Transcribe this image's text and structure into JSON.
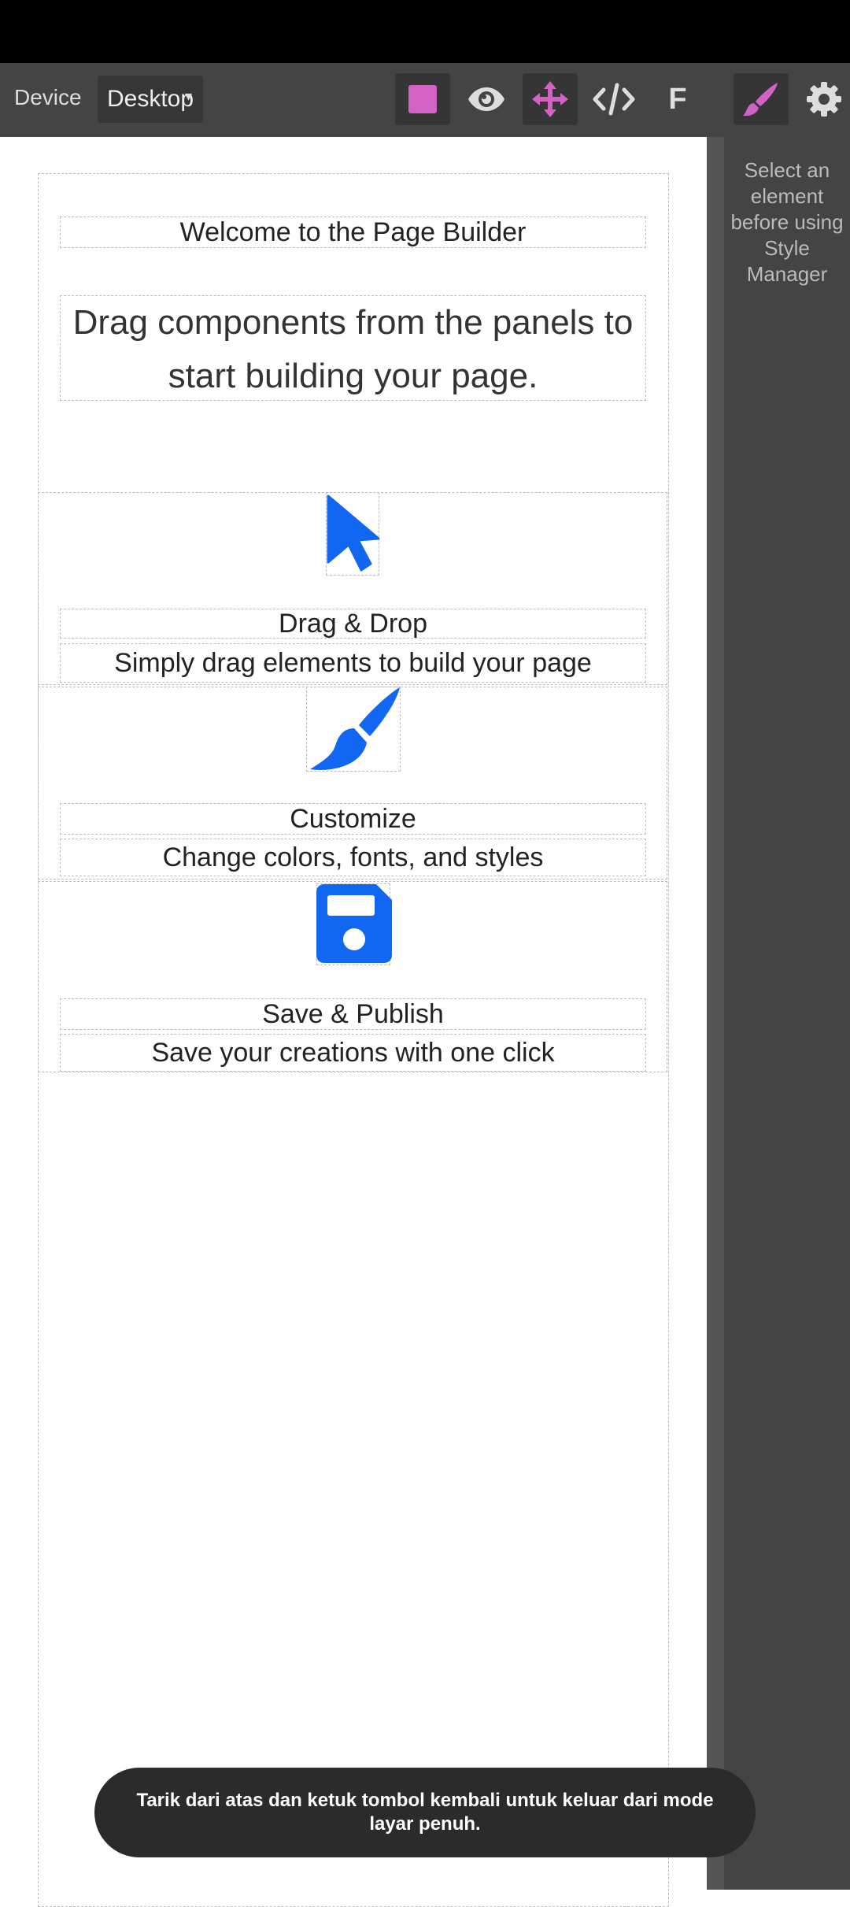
{
  "toolbar": {
    "device_label": "Device",
    "device_value": "Desktop",
    "buttons": {
      "square": "square-icon",
      "preview": "eye-icon",
      "move": "move-icon",
      "code": "code-icon",
      "font_label": "F",
      "style": "paintbrush-icon",
      "settings": "gear-icon"
    },
    "accent": "#d262c4"
  },
  "panel": {
    "message": "Select an element before using Style Manager"
  },
  "canvas": {
    "heading": "Welcome to the Page Builder",
    "intro": "Drag components from the panels to start building your page.",
    "features": [
      {
        "icon": "cursor-icon",
        "title": "Drag & Drop",
        "description": "Simply drag elements to build your page"
      },
      {
        "icon": "brush-icon",
        "title": "Customize",
        "description": "Change colors, fonts, and styles"
      },
      {
        "icon": "save-icon",
        "title": "Save & Publish",
        "description": "Save your creations with one click"
      }
    ],
    "icon_color": "#1167f2"
  },
  "toast": {
    "message": "Tarik dari atas dan ketuk tombol kembali untuk keluar dari mode layar penuh."
  }
}
